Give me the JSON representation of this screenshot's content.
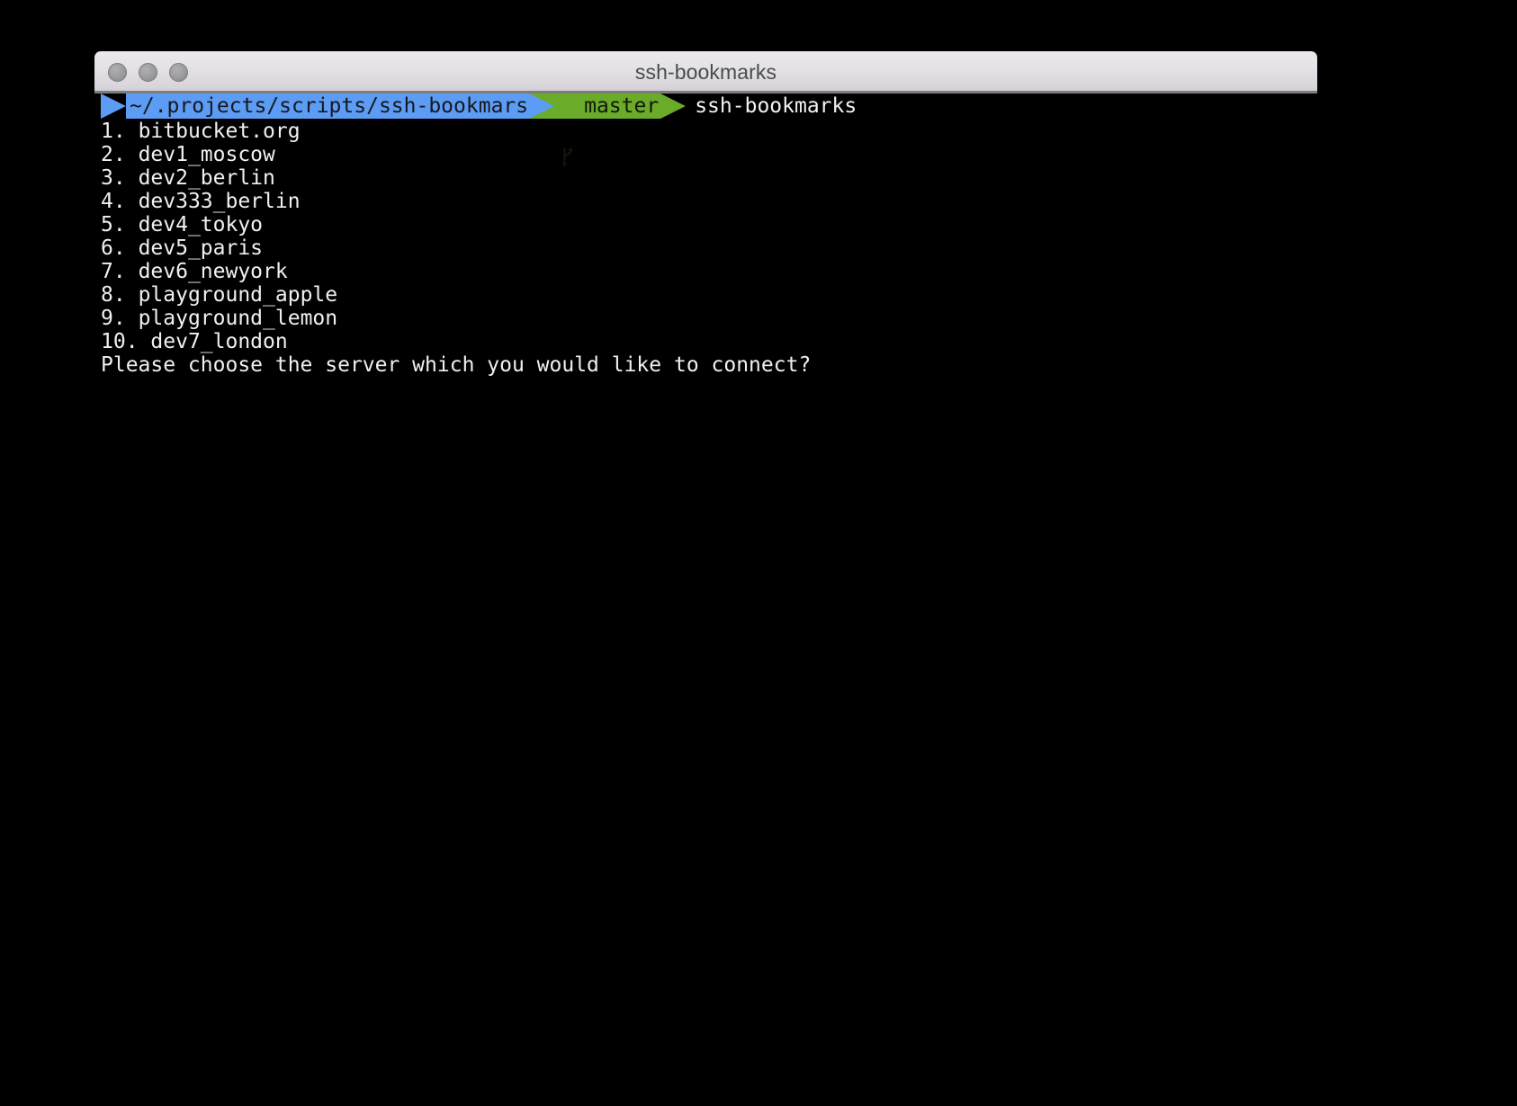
{
  "window": {
    "title": "ssh-bookmarks",
    "traffic_lights": [
      {
        "name": "close",
        "color": "#9b9b9e"
      },
      {
        "name": "minimize",
        "color": "#9b9b9e"
      },
      {
        "name": "zoom",
        "color": "#9b9b9e"
      }
    ]
  },
  "prompt": {
    "path": "~/.projects/scripts/ssh-bookmars",
    "branch_icon": "git-branch-icon",
    "branch": "master",
    "command": "ssh-bookmarks",
    "colors": {
      "path_bg": "#5c9cf5",
      "path_fg": "#16181c",
      "branch_bg": "#6aab2a",
      "branch_fg": "#12180a",
      "command_fg": "#f2f2f2",
      "terminal_bg": "#000000"
    }
  },
  "output": {
    "items": [
      {
        "index": "1.",
        "name": "bitbucket.org"
      },
      {
        "index": "2.",
        "name": "dev1_moscow"
      },
      {
        "index": "3.",
        "name": "dev2_berlin"
      },
      {
        "index": "4.",
        "name": "dev333_berlin"
      },
      {
        "index": "5.",
        "name": "dev4_tokyo"
      },
      {
        "index": "6.",
        "name": "dev5_paris"
      },
      {
        "index": "7.",
        "name": "dev6_newyork"
      },
      {
        "index": "8.",
        "name": "playground_apple"
      },
      {
        "index": "9.",
        "name": "playground_lemon"
      },
      {
        "index": "10.",
        "name": "dev7_london"
      }
    ],
    "question": "Please choose the server which you would like to connect?"
  }
}
